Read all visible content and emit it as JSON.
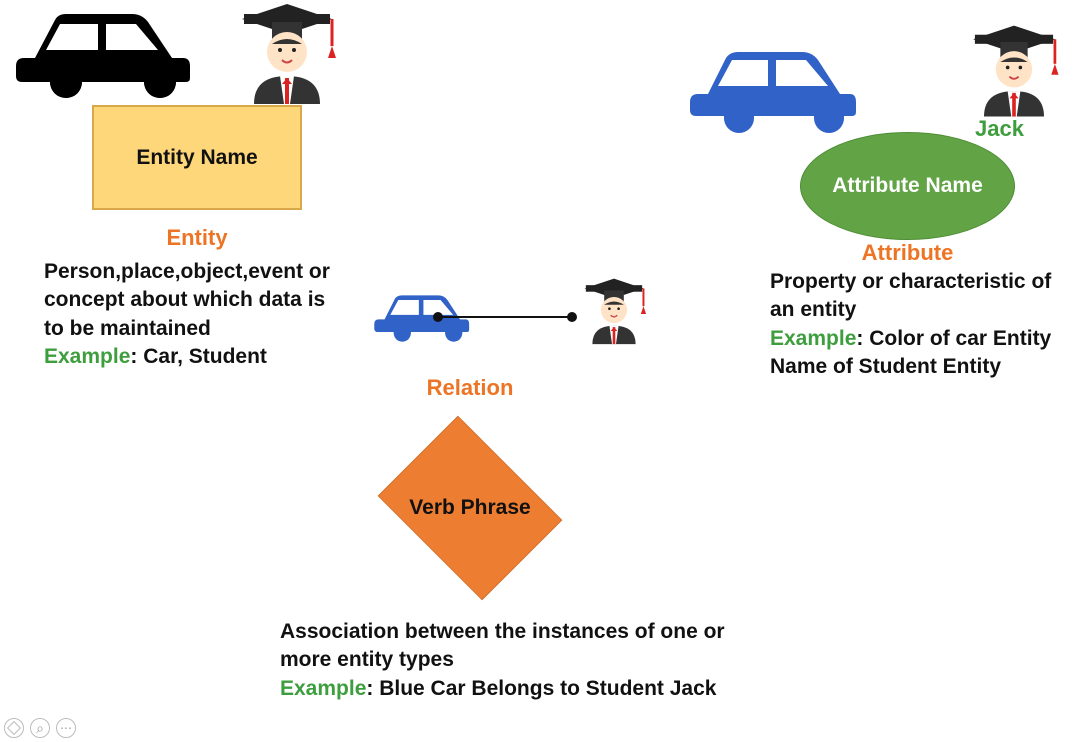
{
  "entity": {
    "box_label": "Entity Name",
    "title": "Entity",
    "description": "Person,place,object,event or concept about which data is to be maintained",
    "example_label": "Example",
    "example_text": ": Car, Student"
  },
  "attribute": {
    "ellipse_lines": "Attribute Name",
    "title": "Attribute",
    "description": "Property or characteristic of an entity",
    "example_label": "Example",
    "example_text": ": Color of car Entity Name of Student Entity",
    "student_name": "Jack"
  },
  "relation": {
    "title": "Relation",
    "diamond_text": "Verb Phrase",
    "description": "Association between the instances of one or more entity types",
    "example_label": "Example",
    "example_text": ": Blue Car Belongs to Student Jack"
  },
  "icons": {
    "car_black": "car-icon",
    "car_blue": "car-icon",
    "student": "student-icon"
  },
  "corner_ui": {
    "pen": "pen-button",
    "zoom": "zoom-button",
    "more": "more-button"
  }
}
